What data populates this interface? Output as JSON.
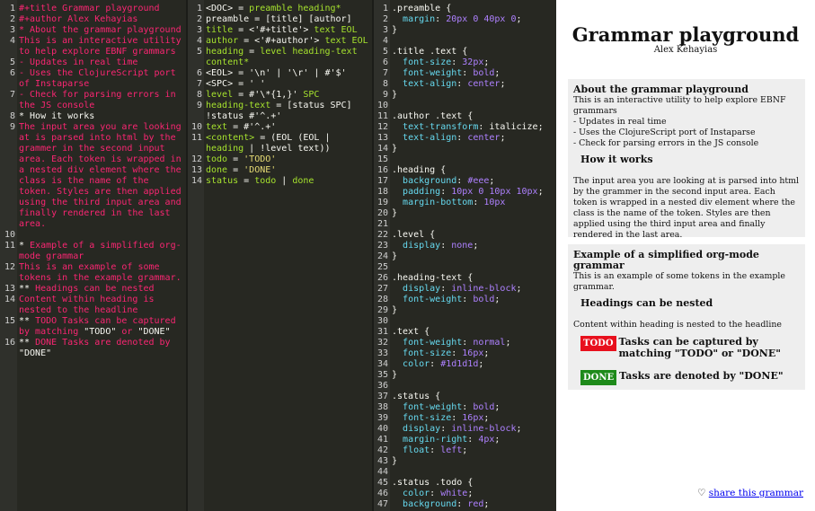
{
  "grammar_source": [
    {
      "n": "1",
      "t": [
        [
          "pk",
          "#+title Grammar playground"
        ]
      ]
    },
    {
      "n": "2",
      "t": [
        [
          "pk",
          "#+author Alex Kehayias"
        ]
      ]
    },
    {
      "n": "3",
      "t": [
        [
          "pk",
          "* About the grammar playground"
        ]
      ]
    },
    {
      "n": "4",
      "t": [
        [
          "pk",
          "This is an interactive utility to help explore EBNF grammars"
        ]
      ]
    },
    {
      "n": "5",
      "t": [
        [
          "pk",
          "- Updates in real time"
        ]
      ]
    },
    {
      "n": "6",
      "t": [
        [
          "pk",
          "- Uses the ClojureScript port of Instaparse"
        ]
      ]
    },
    {
      "n": "7",
      "t": [
        [
          "pk",
          "- Check for parsing errors in the JS console"
        ]
      ]
    },
    {
      "n": "8",
      "t": [
        [
          "w",
          "* How it works"
        ]
      ]
    },
    {
      "n": "9",
      "t": [
        [
          "pk",
          "The input area you are looking at is parsed into html by the grammer in the second input area. Each token is wrapped in a nested div element where the class is the name of the token. Styles are then applied using the third input area and finally rendered in the last area."
        ]
      ]
    },
    {
      "n": "10",
      "t": [
        [
          "w",
          ""
        ]
      ]
    },
    {
      "n": "11",
      "t": [
        [
          "w",
          "* "
        ],
        [
          "pk",
          "Example of a simplified org-mode grammar"
        ]
      ]
    },
    {
      "n": "12",
      "t": [
        [
          "pk",
          "This is an example of some tokens in the example grammar."
        ]
      ]
    },
    {
      "n": "13",
      "t": [
        [
          "w",
          "** "
        ],
        [
          "pk",
          "Headings can be nested"
        ]
      ]
    },
    {
      "n": "14",
      "t": [
        [
          "pk",
          "Content within heading is nested to the headline"
        ]
      ]
    },
    {
      "n": "15",
      "t": [
        [
          "w",
          "** "
        ],
        [
          "pk",
          "TODO Tasks can be captured by matching "
        ],
        [
          "w",
          "\"TODO\""
        ],
        [
          "pk",
          " or "
        ],
        [
          "w",
          "\"DONE\""
        ]
      ]
    },
    {
      "n": "16",
      "t": [
        [
          "w",
          "** "
        ],
        [
          "pk",
          "DONE Tasks are denoted by "
        ],
        [
          "w",
          "\"DONE\""
        ]
      ]
    }
  ],
  "grammar_rules": [
    {
      "n": "1",
      "t": [
        [
          "w",
          "<DOC> = "
        ],
        [
          "g",
          "preamble heading*"
        ]
      ]
    },
    {
      "n": "2",
      "t": [
        [
          "w",
          "preamble = [title] [author]"
        ]
      ]
    },
    {
      "n": "3",
      "t": [
        [
          "g",
          "title"
        ],
        [
          "w",
          " = <'#+title'> "
        ],
        [
          "g",
          "text EOL"
        ]
      ]
    },
    {
      "n": "4",
      "t": [
        [
          "g",
          "author"
        ],
        [
          "w",
          " = <'#+author'> "
        ],
        [
          "g",
          "text EOL"
        ]
      ]
    },
    {
      "n": "5",
      "t": [
        [
          "g",
          "heading"
        ],
        [
          "w",
          " = "
        ],
        [
          "g",
          "level heading-text content*"
        ]
      ]
    },
    {
      "n": "6",
      "t": [
        [
          "w",
          "<EOL> = '\\n' | '\\r' | #'$'"
        ]
      ]
    },
    {
      "n": "7",
      "t": [
        [
          "w",
          "<SPC> = ' '"
        ]
      ]
    },
    {
      "n": "8",
      "t": [
        [
          "g",
          "level"
        ],
        [
          "w",
          " = #'\\*{1,}' "
        ],
        [
          "g",
          "SPC"
        ]
      ]
    },
    {
      "n": "9",
      "t": [
        [
          "g",
          "heading-text"
        ],
        [
          "w",
          " = [status SPC] !status #'^.+'"
        ]
      ]
    },
    {
      "n": "10",
      "t": [
        [
          "g",
          "text"
        ],
        [
          "w",
          " = #'^.+'"
        ]
      ]
    },
    {
      "n": "11",
      "t": [
        [
          "g",
          "<content>"
        ],
        [
          "w",
          " = (EOL (EOL | "
        ],
        [
          "g",
          "heading"
        ],
        [
          "w",
          " | !level text))"
        ]
      ]
    },
    {
      "n": "12",
      "t": [
        [
          "g",
          "todo"
        ],
        [
          "w",
          " = "
        ],
        [
          "y",
          "'TODO'"
        ]
      ]
    },
    {
      "n": "13",
      "t": [
        [
          "g",
          "done"
        ],
        [
          "w",
          " = "
        ],
        [
          "y",
          "'DONE'"
        ]
      ]
    },
    {
      "n": "14",
      "t": [
        [
          "g",
          "status"
        ],
        [
          "w",
          " = "
        ],
        [
          "g",
          "todo"
        ],
        [
          "w",
          " | "
        ],
        [
          "g",
          "done"
        ]
      ]
    }
  ],
  "css_rules": [
    {
      "n": "1",
      "t": [
        [
          "w",
          ".preamble {"
        ]
      ]
    },
    {
      "n": "2",
      "t": [
        [
          "w",
          "  "
        ],
        [
          "c",
          "margin"
        ],
        [
          "w",
          ": "
        ],
        [
          "p",
          "20px 0 40px 0"
        ],
        [
          "w",
          ";"
        ]
      ]
    },
    {
      "n": "3",
      "t": [
        [
          "w",
          "}"
        ]
      ]
    },
    {
      "n": "4",
      "t": [
        [
          "w",
          ""
        ]
      ]
    },
    {
      "n": "5",
      "t": [
        [
          "w",
          ".title .text {"
        ]
      ]
    },
    {
      "n": "6",
      "t": [
        [
          "w",
          "  "
        ],
        [
          "c",
          "font-size"
        ],
        [
          "w",
          ": "
        ],
        [
          "p",
          "32px"
        ],
        [
          "w",
          ";"
        ]
      ]
    },
    {
      "n": "7",
      "t": [
        [
          "w",
          "  "
        ],
        [
          "c",
          "font-weight"
        ],
        [
          "w",
          ": "
        ],
        [
          "p",
          "bold"
        ],
        [
          "w",
          ";"
        ]
      ]
    },
    {
      "n": "8",
      "t": [
        [
          "w",
          "  "
        ],
        [
          "c",
          "text-align"
        ],
        [
          "w",
          ": "
        ],
        [
          "p",
          "center"
        ],
        [
          "w",
          ";"
        ]
      ]
    },
    {
      "n": "9",
      "t": [
        [
          "w",
          "}"
        ]
      ]
    },
    {
      "n": "10",
      "t": [
        [
          "w",
          ""
        ]
      ]
    },
    {
      "n": "11",
      "t": [
        [
          "w",
          ".author .text {"
        ]
      ]
    },
    {
      "n": "12",
      "t": [
        [
          "w",
          "  "
        ],
        [
          "c",
          "text-transform"
        ],
        [
          "w",
          ": italicize;"
        ]
      ]
    },
    {
      "n": "13",
      "t": [
        [
          "w",
          "  "
        ],
        [
          "c",
          "text-align"
        ],
        [
          "w",
          ": "
        ],
        [
          "p",
          "center"
        ],
        [
          "w",
          ";"
        ]
      ]
    },
    {
      "n": "14",
      "t": [
        [
          "w",
          "}"
        ]
      ]
    },
    {
      "n": "15",
      "t": [
        [
          "w",
          ""
        ]
      ]
    },
    {
      "n": "16",
      "t": [
        [
          "w",
          ".heading {"
        ]
      ]
    },
    {
      "n": "17",
      "t": [
        [
          "w",
          "  "
        ],
        [
          "c",
          "background"
        ],
        [
          "w",
          ": "
        ],
        [
          "p",
          "#eee"
        ],
        [
          "w",
          ";"
        ]
      ]
    },
    {
      "n": "18",
      "t": [
        [
          "w",
          "  "
        ],
        [
          "c",
          "padding"
        ],
        [
          "w",
          ": "
        ],
        [
          "p",
          "10px 0 10px 10px"
        ],
        [
          "w",
          ";"
        ]
      ]
    },
    {
      "n": "19",
      "t": [
        [
          "w",
          "  "
        ],
        [
          "c",
          "margin-bottom"
        ],
        [
          "w",
          ": "
        ],
        [
          "p",
          "10px"
        ]
      ]
    },
    {
      "n": "20",
      "t": [
        [
          "w",
          "}"
        ]
      ]
    },
    {
      "n": "21",
      "t": [
        [
          "w",
          ""
        ]
      ]
    },
    {
      "n": "22",
      "t": [
        [
          "w",
          ".level {"
        ]
      ]
    },
    {
      "n": "23",
      "t": [
        [
          "w",
          "  "
        ],
        [
          "c",
          "display"
        ],
        [
          "w",
          ": "
        ],
        [
          "p",
          "none"
        ],
        [
          "w",
          ";"
        ]
      ]
    },
    {
      "n": "24",
      "t": [
        [
          "w",
          "}"
        ]
      ]
    },
    {
      "n": "25",
      "t": [
        [
          "w",
          ""
        ]
      ]
    },
    {
      "n": "26",
      "t": [
        [
          "w",
          ".heading-text {"
        ]
      ]
    },
    {
      "n": "27",
      "t": [
        [
          "w",
          "  "
        ],
        [
          "c",
          "display"
        ],
        [
          "w",
          ": "
        ],
        [
          "p",
          "inline-block"
        ],
        [
          "w",
          ";"
        ]
      ]
    },
    {
      "n": "28",
      "t": [
        [
          "w",
          "  "
        ],
        [
          "c",
          "font-weight"
        ],
        [
          "w",
          ": "
        ],
        [
          "p",
          "bold"
        ],
        [
          "w",
          ";"
        ]
      ]
    },
    {
      "n": "29",
      "t": [
        [
          "w",
          "}"
        ]
      ]
    },
    {
      "n": "30",
      "t": [
        [
          "w",
          ""
        ]
      ]
    },
    {
      "n": "31",
      "t": [
        [
          "w",
          ".text {"
        ]
      ]
    },
    {
      "n": "32",
      "t": [
        [
          "w",
          "  "
        ],
        [
          "c",
          "font-weight"
        ],
        [
          "w",
          ": "
        ],
        [
          "p",
          "normal"
        ],
        [
          "w",
          ";"
        ]
      ]
    },
    {
      "n": "33",
      "t": [
        [
          "w",
          "  "
        ],
        [
          "c",
          "font-size"
        ],
        [
          "w",
          ": "
        ],
        [
          "p",
          "16px"
        ],
        [
          "w",
          ";"
        ]
      ]
    },
    {
      "n": "34",
      "t": [
        [
          "w",
          "  "
        ],
        [
          "c",
          "color"
        ],
        [
          "w",
          ": "
        ],
        [
          "p",
          "#1d1d1d"
        ],
        [
          "w",
          ";"
        ]
      ]
    },
    {
      "n": "35",
      "t": [
        [
          "w",
          "}"
        ]
      ]
    },
    {
      "n": "36",
      "t": [
        [
          "w",
          ""
        ]
      ]
    },
    {
      "n": "37",
      "t": [
        [
          "w",
          ".status {"
        ]
      ]
    },
    {
      "n": "38",
      "t": [
        [
          "w",
          "  "
        ],
        [
          "c",
          "font-weight"
        ],
        [
          "w",
          ": "
        ],
        [
          "p",
          "bold"
        ],
        [
          "w",
          ";"
        ]
      ]
    },
    {
      "n": "39",
      "t": [
        [
          "w",
          "  "
        ],
        [
          "c",
          "font-size"
        ],
        [
          "w",
          ": "
        ],
        [
          "p",
          "16px"
        ],
        [
          "w",
          ";"
        ]
      ]
    },
    {
      "n": "40",
      "t": [
        [
          "w",
          "  "
        ],
        [
          "c",
          "display"
        ],
        [
          "w",
          ": "
        ],
        [
          "p",
          "inline-block"
        ],
        [
          "w",
          ";"
        ]
      ]
    },
    {
      "n": "41",
      "t": [
        [
          "w",
          "  "
        ],
        [
          "c",
          "margin-right"
        ],
        [
          "w",
          ": "
        ],
        [
          "p",
          "4px"
        ],
        [
          "w",
          ";"
        ]
      ]
    },
    {
      "n": "42",
      "t": [
        [
          "w",
          "  "
        ],
        [
          "c",
          "float"
        ],
        [
          "w",
          ": "
        ],
        [
          "p",
          "left"
        ],
        [
          "w",
          ";"
        ]
      ]
    },
    {
      "n": "43",
      "t": [
        [
          "w",
          "}"
        ]
      ]
    },
    {
      "n": "44",
      "t": [
        [
          "w",
          ""
        ]
      ]
    },
    {
      "n": "45",
      "t": [
        [
          "w",
          ".status .todo {"
        ]
      ]
    },
    {
      "n": "46",
      "t": [
        [
          "w",
          "  "
        ],
        [
          "c",
          "color"
        ],
        [
          "w",
          ": "
        ],
        [
          "p",
          "white"
        ],
        [
          "w",
          ";"
        ]
      ]
    },
    {
      "n": "47",
      "t": [
        [
          "w",
          "  "
        ],
        [
          "c",
          "background"
        ],
        [
          "w",
          ": "
        ],
        [
          "p",
          "red"
        ],
        [
          "w",
          ";"
        ]
      ]
    }
  ],
  "preview": {
    "title": "Grammar playground",
    "author": "Alex Kehayias",
    "section1": {
      "heading": "About the grammar playground",
      "intro": "This is an interactive utility to help explore EBNF grammars",
      "bullets": [
        "- Updates in real time",
        "- Uses the ClojureScript port of Instaparse",
        "- Check for parsing errors in the JS console"
      ],
      "subheading": "How it works",
      "body": "The input area you are looking at is parsed into html by the grammer in the second input area. Each token is wrapped in a nested div element where the class is the name of the token. Styles are then applied using the third input area and finally rendered in the last area."
    },
    "section2": {
      "heading": "Example of a simplified org-mode grammar",
      "intro": "This is an example of some tokens in the example grammar.",
      "subheading": "Headings can be nested",
      "content": "Content within heading is nested to the headline",
      "todo_badge": "TODO",
      "todo_text": "Tasks can be captured by matching \"TODO\" or \"DONE\"",
      "done_badge": "DONE",
      "done_text": "Tasks are denoted by \"DONE\""
    },
    "share_icon": "♡",
    "share_label": "share this grammar"
  },
  "colors": {
    "editor_bg": "#272822",
    "pink": "#f92672",
    "green": "#a6e22e",
    "yellow": "#e6db74",
    "purple": "#ae81ff",
    "cyan": "#66d9ef",
    "todo": "#e8101d",
    "done": "#1e8a1a"
  }
}
